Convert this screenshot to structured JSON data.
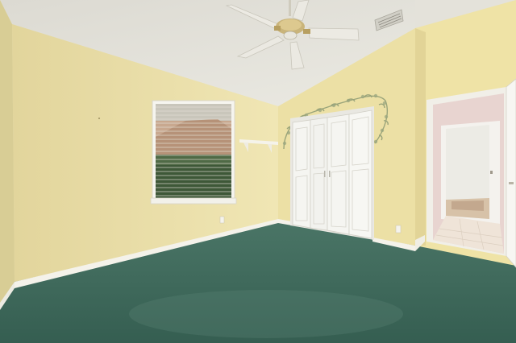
{
  "scene": {
    "colors": {
      "ceiling": "#e6e4dd",
      "left_wall": "#ede3ad",
      "back_wall": "#e8dca0",
      "right_wall": "#efe2a4",
      "carpet": "#3d6a5c",
      "carpet_light": "#537d6e",
      "baseboard": "#f4f2ea",
      "door_white": "#f3f3ef",
      "hall_wall": "#e9d6d3",
      "tile": "#efe5da"
    },
    "icons": [
      "ceiling-fan-icon",
      "air-vent-icon",
      "window-icon",
      "closet-door-icon",
      "wall-shelf-icon",
      "ivy-stencil-icon",
      "outlet-icon"
    ]
  }
}
